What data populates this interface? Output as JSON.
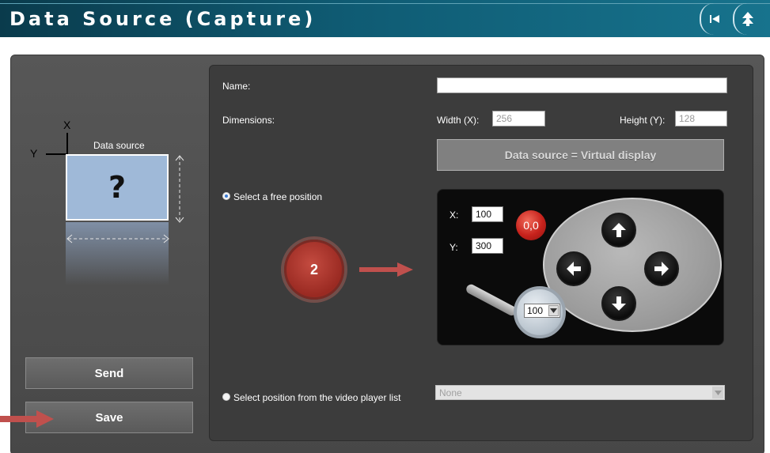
{
  "header": {
    "title": "Data Source (Capture)"
  },
  "diagram": {
    "x_axis": "X",
    "y_axis": "Y",
    "box_label": "Data source",
    "box_symbol": "?"
  },
  "buttons": {
    "send": "Send",
    "save": "Save"
  },
  "form": {
    "name_label": "Name:",
    "name_value": "",
    "dimensions_label": "Dimensions:",
    "width_label": "Width (X):",
    "width_value": "256",
    "height_label": "Height (Y):",
    "height_value": "128",
    "virtual_display_label": "Data source = Virtual display",
    "free_position_label": "Select a free position",
    "video_list_label": "Select position from the video player list",
    "video_list_value": "None"
  },
  "position": {
    "x_label": "X:",
    "x_value": "100",
    "y_label": "Y:",
    "y_value": "300",
    "origin_label": "0,0",
    "zoom_value": "100"
  },
  "callout": {
    "number": "2"
  },
  "colors": {
    "accent_red": "#c7221c",
    "header_bg": "#0f5b73",
    "arrow_red": "#c0504d"
  }
}
